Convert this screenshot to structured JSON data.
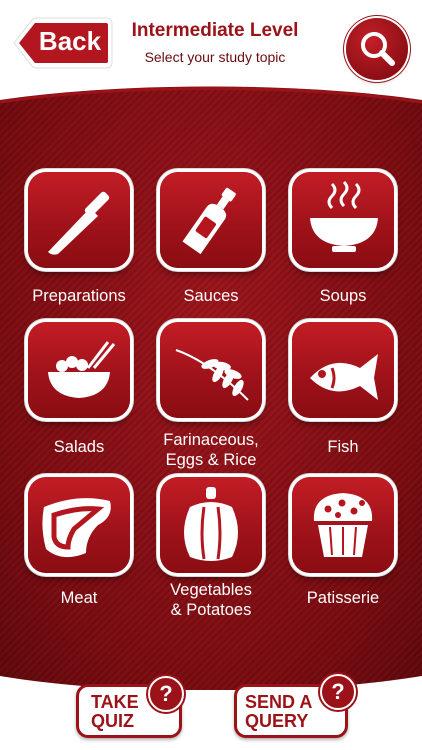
{
  "header": {
    "back_label": "Back",
    "title": "Intermediate Level",
    "subtitle": "Select your study topic"
  },
  "topics": [
    {
      "label": "Preparations",
      "icon": "knife-icon"
    },
    {
      "label": "Sauces",
      "icon": "sauce-bottle-icon"
    },
    {
      "label": "Soups",
      "icon": "soup-bowl-icon"
    },
    {
      "label": "Salads",
      "icon": "salad-bowl-icon"
    },
    {
      "label": "Farinaceous,\nEggs & Rice",
      "icon": "wheat-icon"
    },
    {
      "label": "Fish",
      "icon": "fish-icon"
    },
    {
      "label": "Meat",
      "icon": "steak-icon"
    },
    {
      "label": "Vegetables\n& Potatoes",
      "icon": "pepper-icon"
    },
    {
      "label": "Patisserie",
      "icon": "muffin-icon"
    }
  ],
  "footer": {
    "quiz_line1": "TAKE",
    "quiz_line2": "QUIZ",
    "query_line1": "SEND A",
    "query_line2": "QUERY",
    "badge": "?"
  },
  "colors": {
    "brand_red": "#9b1218",
    "background_maroon": "#7a0b10",
    "tile_red": "#b3161e"
  }
}
